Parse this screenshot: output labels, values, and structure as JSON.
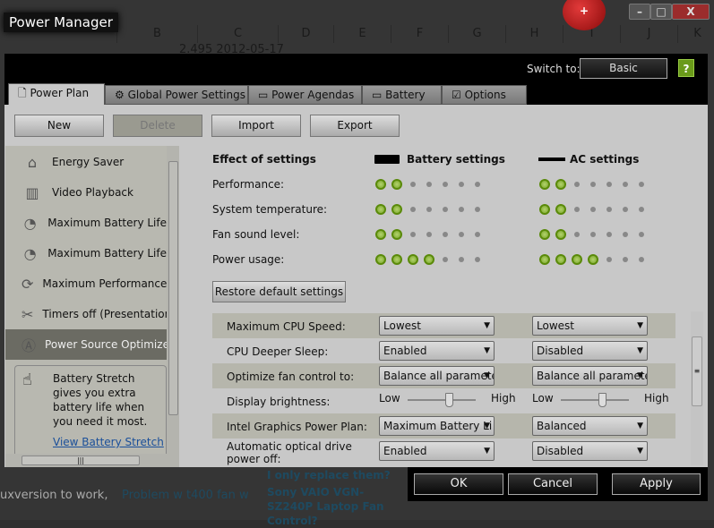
{
  "background": {
    "columns": [
      "B",
      "C",
      "D",
      "E",
      "F",
      "G",
      "H",
      "I",
      "J",
      "K"
    ],
    "cell_text": "2.495  2012-05-17",
    "bottom_text": "uxversion to work,",
    "bottom_link": "Problem w t400 fan w",
    "link1": "I only replace them?",
    "link2": "Sony VAIO VGN-SZ240P Laptop Fan Control?"
  },
  "window": {
    "title": "Power Manager",
    "minimize": "–",
    "maximize": "□",
    "close": "X",
    "switch_label": "Switch to:",
    "switch_button": "Basic",
    "help": "?"
  },
  "tabs": [
    {
      "label": "Power Plan",
      "icon": "document-icon",
      "active": true
    },
    {
      "label": "Global Power Settings",
      "icon": "gear-icon"
    },
    {
      "label": "Power Agendas",
      "icon": "calendar-clock-icon"
    },
    {
      "label": "Battery",
      "icon": "battery-icon"
    },
    {
      "label": "Options",
      "icon": "checkbox-icon"
    }
  ],
  "toolbar": {
    "new": "New",
    "delete": "Delete",
    "import": "Import",
    "export": "Export"
  },
  "plans": [
    {
      "label": "Energy Saver",
      "icon": "house-icon"
    },
    {
      "label": "Video Playback",
      "icon": "film-icon"
    },
    {
      "label": "Maximum Battery Life",
      "icon": "battery-clock-icon"
    },
    {
      "label": "Maximum Battery Life",
      "icon": "battery-clock-icon"
    },
    {
      "label": "Maximum Performance",
      "icon": "power-icon"
    },
    {
      "label": "Timers off (Presentation)",
      "icon": "tag-icon"
    },
    {
      "label": "Power Source Optimized",
      "icon": "auto-icon",
      "selected": true
    }
  ],
  "tip": {
    "text": "Battery Stretch gives you extra battery life when you need it most.",
    "link": "View Battery Stretch"
  },
  "effects": {
    "title": "Effect of settings",
    "battery_header": "Battery settings",
    "ac_header": "AC settings",
    "max_level": 7,
    "rows": [
      {
        "label": "Performance:",
        "battery": 2,
        "ac": 2
      },
      {
        "label": "System temperature:",
        "battery": 2,
        "ac": 2
      },
      {
        "label": "Fan sound level:",
        "battery": 2,
        "ac": 2
      },
      {
        "label": "Power usage:",
        "battery": 4,
        "ac": 4
      }
    ],
    "active_color": "#7aa62a"
  },
  "restore": "Restore default settings",
  "settings": [
    {
      "label": "Maximum CPU Speed:",
      "battery": "Lowest",
      "ac": "Lowest"
    },
    {
      "label": "CPU Deeper Sleep:",
      "battery": "Enabled",
      "ac": "Disabled"
    },
    {
      "label": "Optimize fan control to:",
      "battery": "Balance all paramete",
      "ac": "Balance all paramete"
    },
    {
      "label": "Display brightness:",
      "slider": true,
      "low": "Low",
      "high": "High",
      "battery_level": 0.6,
      "ac_level": 0.6
    },
    {
      "label": "Intel Graphics Power Plan:",
      "battery": "Maximum Battery Li",
      "ac": "Balanced"
    },
    {
      "label": "Automatic optical drive power off:",
      "battery": "Enabled",
      "ac": "Disabled"
    }
  ],
  "footer": {
    "ok": "OK",
    "cancel": "Cancel",
    "apply": "Apply"
  }
}
